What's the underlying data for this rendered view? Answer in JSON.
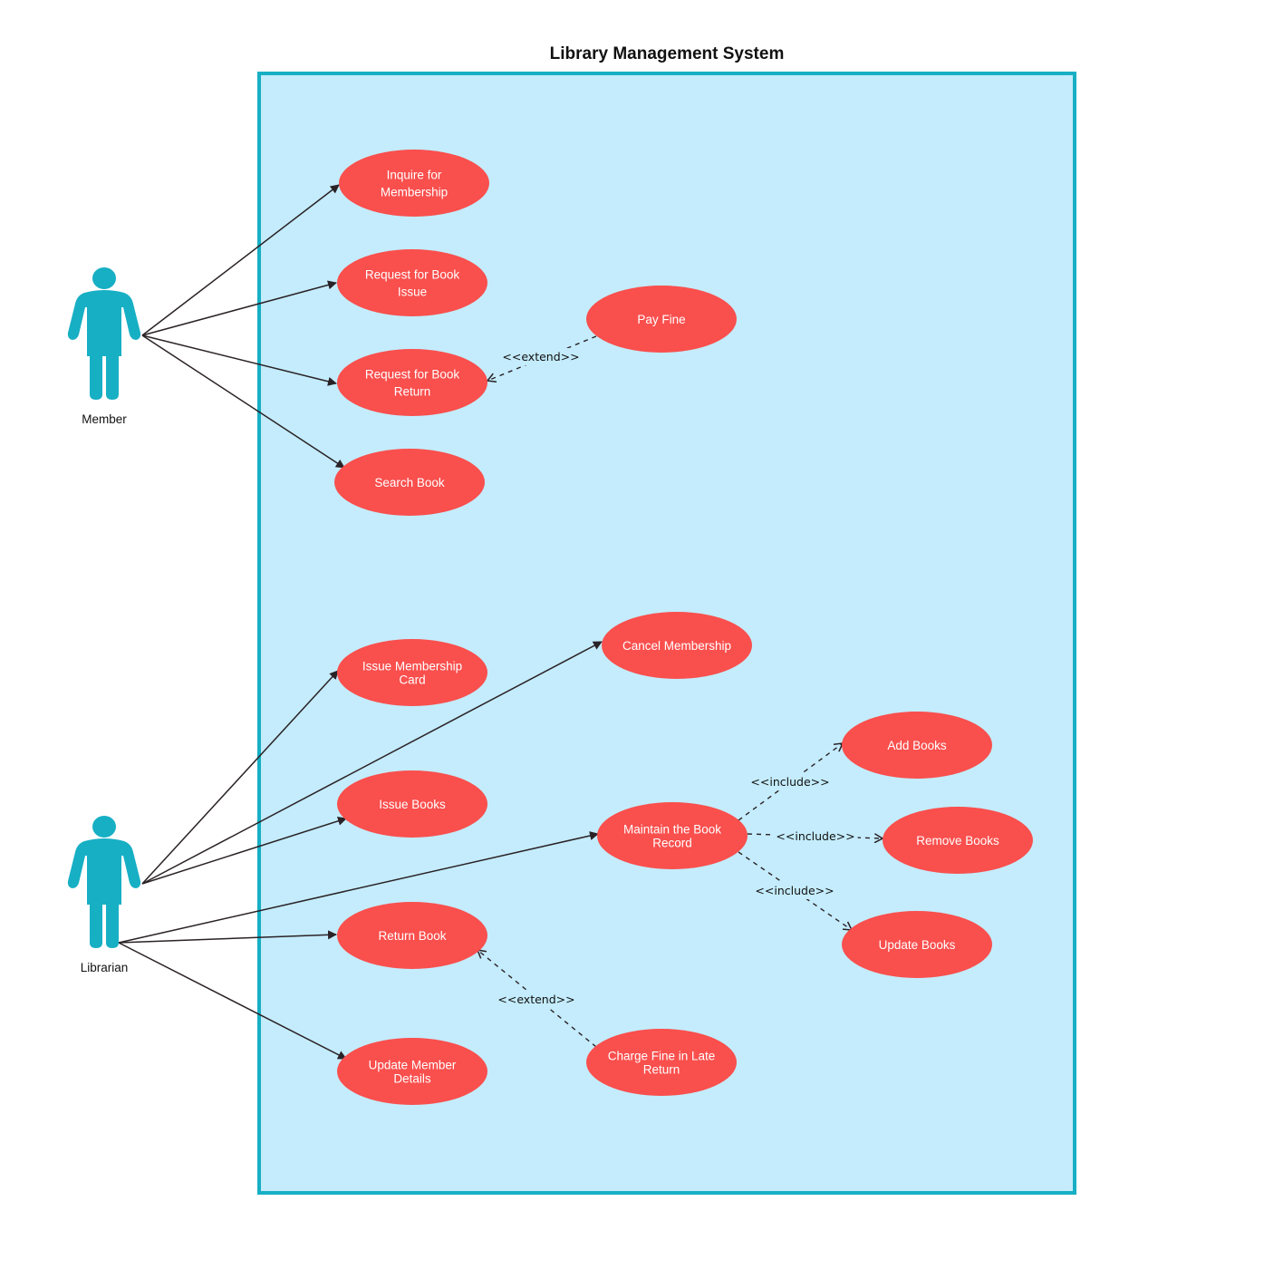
{
  "diagram": {
    "title": "Library Management System",
    "colors": {
      "system_fill": "#c4ecfc",
      "system_border": "#17afc4",
      "actor": "#17afc4",
      "usecase_fill": "#f94f4d",
      "usecase_text": "#ffffff",
      "line": "#2a2226"
    },
    "actors": [
      {
        "id": "member",
        "label": "Member"
      },
      {
        "id": "librarian",
        "label": "Librarian"
      }
    ],
    "use_cases": [
      {
        "id": "inquire",
        "lines": [
          "Inquire for",
          "Membership"
        ]
      },
      {
        "id": "req_issue",
        "lines": [
          "Request for Book",
          "Issue"
        ]
      },
      {
        "id": "req_return",
        "lines": [
          "Request for Book",
          "Return"
        ]
      },
      {
        "id": "search",
        "lines": [
          "Search Book"
        ]
      },
      {
        "id": "pay_fine",
        "lines": [
          "Pay Fine"
        ]
      },
      {
        "id": "issue_card",
        "lines": [
          "Issue Membership",
          "Card"
        ]
      },
      {
        "id": "cancel",
        "lines": [
          "Cancel Membership"
        ]
      },
      {
        "id": "issue_books",
        "lines": [
          "Issue Books"
        ]
      },
      {
        "id": "maintain",
        "lines": [
          "Maintain the Book",
          "Record"
        ]
      },
      {
        "id": "add",
        "lines": [
          "Add Books"
        ]
      },
      {
        "id": "remove",
        "lines": [
          "Remove Books"
        ]
      },
      {
        "id": "update",
        "lines": [
          "Update Books"
        ]
      },
      {
        "id": "return_book",
        "lines": [
          "Return Book"
        ]
      },
      {
        "id": "update_member",
        "lines": [
          "Update Member",
          "Details"
        ]
      },
      {
        "id": "charge_fine",
        "lines": [
          "Charge Fine in Late",
          "Return"
        ]
      }
    ],
    "associations": [
      {
        "from": "member",
        "to": "inquire"
      },
      {
        "from": "member",
        "to": "req_issue"
      },
      {
        "from": "member",
        "to": "req_return"
      },
      {
        "from": "member",
        "to": "search"
      },
      {
        "from": "librarian",
        "to": "issue_card"
      },
      {
        "from": "librarian",
        "to": "cancel"
      },
      {
        "from": "librarian",
        "to": "issue_books"
      },
      {
        "from": "librarian",
        "to": "maintain"
      },
      {
        "from": "librarian",
        "to": "return_book"
      },
      {
        "from": "librarian",
        "to": "update_member"
      }
    ],
    "dependencies": [
      {
        "from": "pay_fine",
        "to": "req_return",
        "label": "<<extend>>"
      },
      {
        "from": "maintain",
        "to": "add",
        "label": "<<include>>"
      },
      {
        "from": "maintain",
        "to": "remove",
        "label": "<<include>>"
      },
      {
        "from": "maintain",
        "to": "update",
        "label": "<<include>>"
      },
      {
        "from": "charge_fine",
        "to": "return_book",
        "label": "<<extend>>"
      }
    ]
  }
}
